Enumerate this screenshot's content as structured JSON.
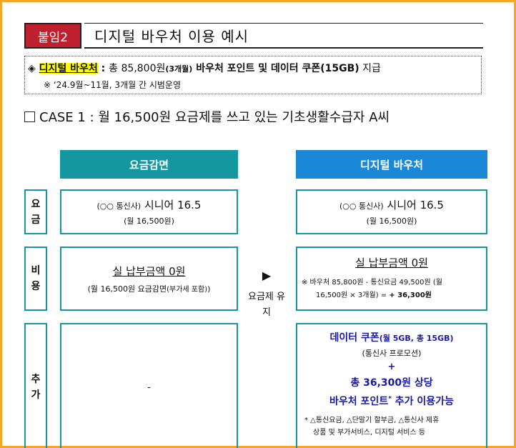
{
  "header": {
    "badge": "붙임2",
    "title": "디지털 바우처 이용 예시"
  },
  "info": {
    "bullet": "◈",
    "highlight": "디지털 바우처",
    "sep": " : ",
    "text_a": "총 85,800원",
    "text_a_small": "(3개월)",
    "text_b": " 바우처 포인트 및 데이터 쿠폰(15GB)",
    "text_c": " 지급",
    "note": "※ ‘24.9월~11월, 3개월 간 시범운영"
  },
  "case": {
    "text": "CASE 1 : 월 16,500원 요금제를 쓰고 있는 기초생활수급자 A씨"
  },
  "columns": {
    "left_header": "요금감면",
    "right_header": "디지털 바우처"
  },
  "rows": {
    "fee": {
      "label": [
        "요",
        "금"
      ],
      "left_l1_small": "(○○ 통신사)",
      "left_l1_big": " 시니어 16.5",
      "left_l2": "(월 16,500원)",
      "right_l1_small": "(○○ 통신사)",
      "right_l1_big": " 시니어 16.5",
      "right_l2": "(월 16,500원)"
    },
    "cost": {
      "label": [
        "비",
        "용"
      ],
      "left_main": "실 납부금액 0원",
      "left_sub": "(월 16,500원 요금감면",
      "left_sub_small": "(부가세 포함)",
      "left_sub_end": ")",
      "right_main": "실 납부금액 0원",
      "right_sub_l1": "※  바우처 85,800원 - 통신요금 49,500원 (월",
      "right_sub_l2a": "16,500원 × 3개월) = ",
      "right_sub_l2b": "+ 36,300원"
    },
    "extra": {
      "label": [
        "추",
        "가"
      ],
      "left_value": "-",
      "coupon": "데이터 쿠폰",
      "coupon_small": "(월 5GB, 총 15GB)",
      "promo": "(통신사 프로모션)",
      "plus": "+",
      "total": "총 36,300원 상당",
      "voucher": "바우처 포인트",
      "voucher_sup": "*",
      "voucher_end": " 추가 이용가능",
      "foot_l1": "* △통신요금, △단말기 할부금, △통신사 제휴",
      "foot_l2": "상품 및 부가서비스, 디지털 서비스 등"
    }
  },
  "arrow": {
    "text_l1": "요금제 유",
    "text_l2": "지"
  },
  "colors": {
    "badge": "#c0202e",
    "teal": "#1597a0",
    "blue": "#1a88d6",
    "frame": "#f5a623",
    "highlight": "#ffff00",
    "navy": "#1a1aa8"
  }
}
